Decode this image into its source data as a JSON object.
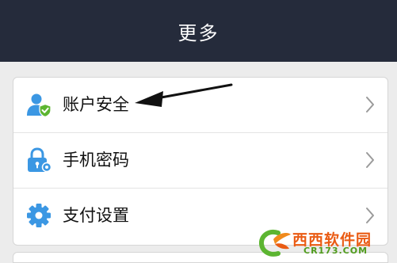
{
  "header": {
    "title": "更多"
  },
  "menu": {
    "items": [
      {
        "label": "账户安全",
        "icon": "account-security-icon"
      },
      {
        "label": "手机密码",
        "icon": "phone-lock-icon"
      },
      {
        "label": "支付设置",
        "icon": "gear-icon"
      }
    ]
  },
  "watermark": {
    "brand": "西西软件园",
    "domain": "CR173.COM"
  },
  "colors": {
    "header_bg": "#252b3b",
    "page_bg": "#ececec",
    "icon_blue": "#3b97e3",
    "badge_green": "#5cb531",
    "watermark_orange": "#ea5b13",
    "watermark_green": "#4f9b1c"
  }
}
